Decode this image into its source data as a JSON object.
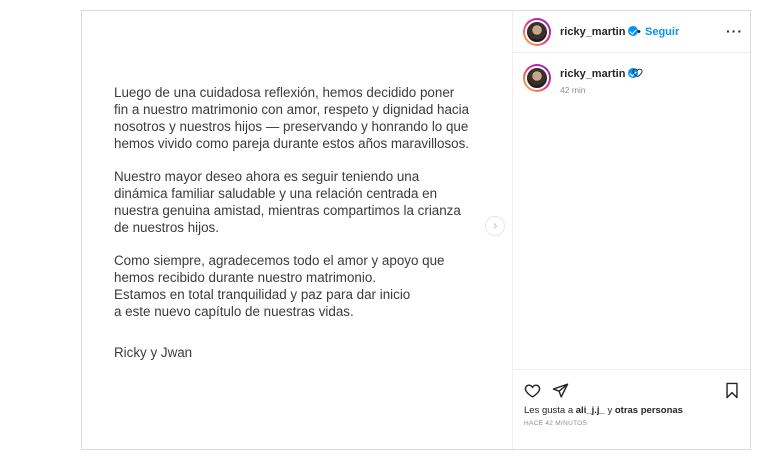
{
  "letter": {
    "paragraphs": [
      "Luego de una cuidadosa reflexión, hemos decidido poner\nfin a nuestro matrimonio con amor, respeto y dignidad hacia\nnosotros y nuestros hijos — preservando y honrando lo que\nhemos vivido como pareja durante estos años maravillosos.",
      "Nuestro mayor deseo ahora es seguir teniendo una\ndinámica familiar saludable y una relación centrada en\nnuestra genuina amistad, mientras compartimos la crianza\nde nuestros hijos.",
      "Como siempre, agradecemos todo el amor y apoyo que\nhemos recibido durante nuestro matrimonio.\nEstamos en total tranquilidad y paz para dar inicio\na este nuevo capítulo de nuestras vidas.",
      "Ricky y Jwan"
    ]
  },
  "header": {
    "username": "ricky_martin",
    "separator": "•",
    "follow_label": "Seguir",
    "more_label": "···"
  },
  "caption": {
    "username": "ricky_martin",
    "time": "42 min"
  },
  "footer": {
    "likes_prefix": "Les gusta a ",
    "likes_user": "ali_j.j_",
    "likes_mid": " y ",
    "likes_others": "otras personas",
    "posted": "HACE 42 MINUTOS"
  },
  "icons": {
    "verified": "verified-badge-icon",
    "like": "heart-icon",
    "share": "paper-plane-icon",
    "save": "bookmark-icon",
    "next": "chevron-right-icon"
  },
  "colors": {
    "accent": "#0095f6",
    "text": "#262626",
    "muted": "#8e8e8e",
    "border": "#dbdbdb"
  }
}
